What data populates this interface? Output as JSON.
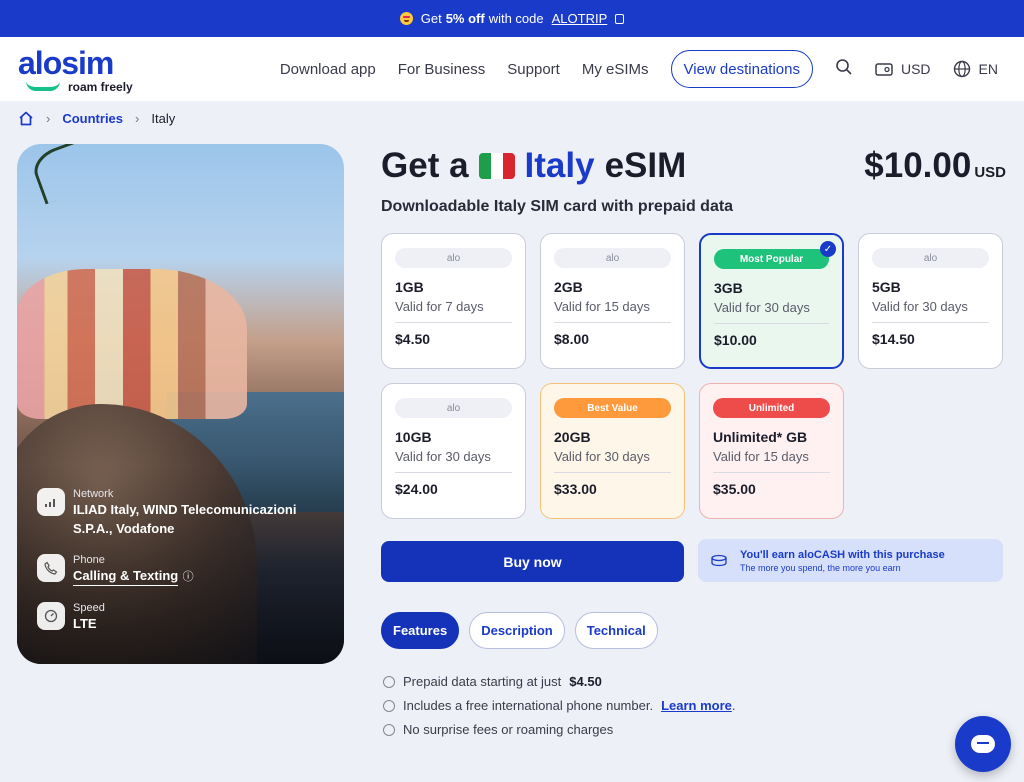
{
  "promo": {
    "prefix": "Get",
    "bold": "5% off",
    "suffix": "with code",
    "code": "ALOTRIP"
  },
  "nav": {
    "logo_word": "alosim",
    "logo_tag": "roam freely",
    "links": [
      "Download app",
      "For Business",
      "Support",
      "My eSIMs"
    ],
    "cta": "View destinations",
    "currency": "USD",
    "language": "EN"
  },
  "breadcrumb": {
    "link": "Countries",
    "current": "Italy"
  },
  "hero": {
    "network_label": "Network",
    "network_value": "ILIAD Italy, WIND Telecomunicazioni S.P.A., Vodafone",
    "phone_label": "Phone",
    "phone_value": "Calling & Texting",
    "speed_label": "Speed",
    "speed_value": "LTE"
  },
  "title": {
    "prefix": "Get a",
    "country": "Italy",
    "suffix": "eSIM"
  },
  "price": {
    "amount": "$10.00",
    "currency": "USD"
  },
  "subtitle": "Downloadable Italy SIM card with prepaid data",
  "plans": [
    {
      "badge": "alo",
      "data": "1GB",
      "validity": "Valid for 7 days",
      "price": "$4.50"
    },
    {
      "badge": "alo",
      "data": "2GB",
      "validity": "Valid for 15 days",
      "price": "$8.00"
    },
    {
      "badge": "Most Popular",
      "data": "3GB",
      "validity": "Valid for 30 days",
      "price": "$10.00",
      "check": "✓"
    },
    {
      "badge": "alo",
      "data": "5GB",
      "validity": "Valid for 30 days",
      "price": "$14.50"
    },
    {
      "badge": "alo",
      "data": "10GB",
      "validity": "Valid for 30 days",
      "price": "$24.00"
    },
    {
      "badge": "Best Value",
      "data": "20GB",
      "validity": "Valid for 30 days",
      "price": "$33.00"
    },
    {
      "badge": "Unlimited",
      "data": "Unlimited* GB",
      "validity": "Valid for 15 days",
      "price": "$35.00"
    }
  ],
  "buy_label": "Buy now",
  "earn": {
    "title": "You'll earn aloCASH with this purchase",
    "note": "The more you spend, the more you earn"
  },
  "tabs": [
    "Features",
    "Description",
    "Technical"
  ],
  "features": {
    "f1_text": "Prepaid data starting at just",
    "f1_bold": "$4.50",
    "f2_text": "Includes a free international phone number.",
    "f2_link": "Learn more",
    "f2_end": ".",
    "f3_text": "No surprise fees or roaming charges"
  },
  "colors": {
    "brand": "#1a3bc9",
    "green": "#1ec27a",
    "orange": "#ff9a3c",
    "red": "#ee4b4b"
  }
}
